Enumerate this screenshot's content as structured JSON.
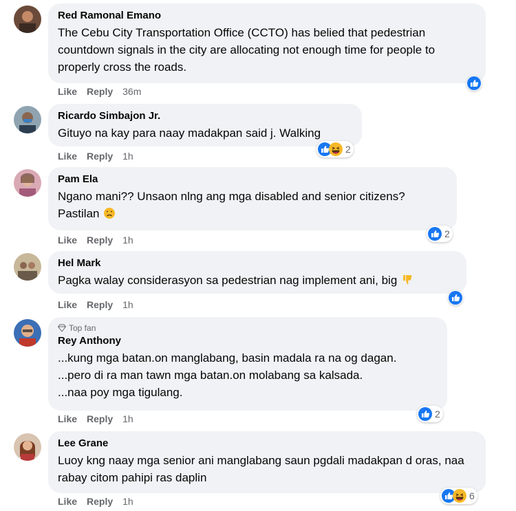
{
  "comments": [
    {
      "name": "Red Ramonal Emano",
      "text": "The Cebu City Transportation Office (CCTO) has belied that pedestrian countdown signals in the city are allocating not enough time for people to properly cross the roads.",
      "actions": {
        "like": "Like",
        "reply": "Reply",
        "time": "36m"
      },
      "reaction": {
        "icons": [
          "like-icon"
        ],
        "count": ""
      }
    },
    {
      "name": "Ricardo Simbajon Jr.",
      "text": "Gituyo na kay para naay madakpan said j. Walking",
      "actions": {
        "like": "Like",
        "reply": "Reply",
        "time": "1h"
      },
      "reaction": {
        "icons": [
          "like-icon",
          "haha-icon"
        ],
        "count": "2"
      }
    },
    {
      "name": "Pam Ela",
      "text_line1": "Ngano mani?? Unsaon nlng ang mga disabled and senior citizens?",
      "text_line2": "Pastilan",
      "actions": {
        "like": "Like",
        "reply": "Reply",
        "time": "1h"
      },
      "reaction": {
        "icons": [
          "like-icon"
        ],
        "count": "2"
      }
    },
    {
      "name": "Hel Mark",
      "text": "Pagka walay considerasyon sa pedestrian nag implement ani, big",
      "actions": {
        "like": "Like",
        "reply": "Reply",
        "time": "1h"
      },
      "reaction": {
        "icons": [
          "like-icon"
        ],
        "count": ""
      }
    },
    {
      "badge": "Top fan",
      "name": "Rey Anthony",
      "lines": [
        "...kung mga batan.on manglabang, basin madala ra na og dagan.",
        "...pero di ra man tawn mga batan.on molabang sa kalsada.",
        "...naa poy mga tigulang."
      ],
      "actions": {
        "like": "Like",
        "reply": "Reply",
        "time": "1h"
      },
      "reaction": {
        "icons": [
          "like-icon"
        ],
        "count": "2"
      }
    },
    {
      "name": "Lee Grane",
      "text": "Luoy kng naay mga senior ani manglabang saun pgdali madakpan d oras, naa rabay citom pahipi ras daplin",
      "actions": {
        "like": "Like",
        "reply": "Reply",
        "time": "1h"
      },
      "reaction": {
        "icons": [
          "like-icon",
          "haha-icon"
        ],
        "count": "6"
      }
    }
  ],
  "colors": {
    "bubble": "#f0f2f5",
    "like_blue": "#1877f2",
    "meta": "#65676b",
    "haha_yellow": "#f7b928"
  }
}
